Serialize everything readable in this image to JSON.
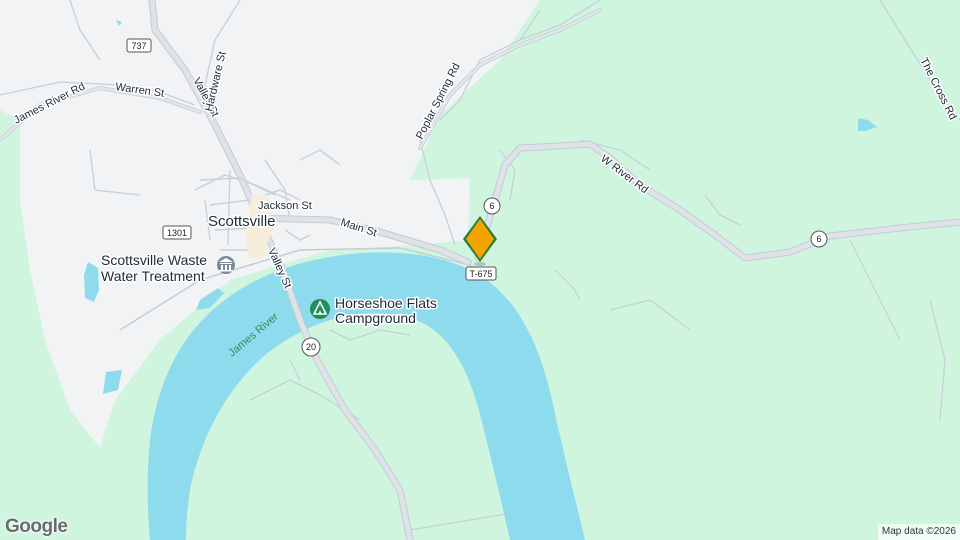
{
  "map": {
    "colors": {
      "land": "#cff5df",
      "town": "#f1f3f4",
      "water": "#8fdbee",
      "road": "#d4dbe4",
      "road_edge": "#b7c0ca",
      "marker": "#f5a300",
      "marker_border": "#2e7d32",
      "park_icon": "#1e8e5a",
      "river_label": "#2f8f5b"
    },
    "place_labels": {
      "town": "Scottsville",
      "waste_water_line1": "Scottsville Waste",
      "waste_water_line2": "Water Treatment",
      "campground_line1": "Horseshoe Flats",
      "campground_line2": "Campground"
    },
    "road_labels": {
      "james_river_rd": "James River Rd",
      "warren_st": "Warren St",
      "valley_st_north": "Valley St",
      "hardware_st": "Hardware St",
      "poplar_spring_rd": "Poplar Spring Rd",
      "jackson_st": "Jackson St",
      "main_st": "Main St",
      "valley_st_south": "Valley St",
      "w_river_rd": "W River Rd",
      "the_cross_rd": "The Cross Rd"
    },
    "water_labels": {
      "james_river": "James River"
    },
    "shields": {
      "s737": "737",
      "s1301": "1301",
      "s6_north": "6",
      "s6_east": "6",
      "s20": "20",
      "t675": "T-675"
    },
    "icons": {
      "campground": "campground-icon",
      "treatment": "government-building-icon",
      "marker": "location-pin-icon"
    },
    "attribution": "Map data ©2026",
    "logo": "Google"
  }
}
